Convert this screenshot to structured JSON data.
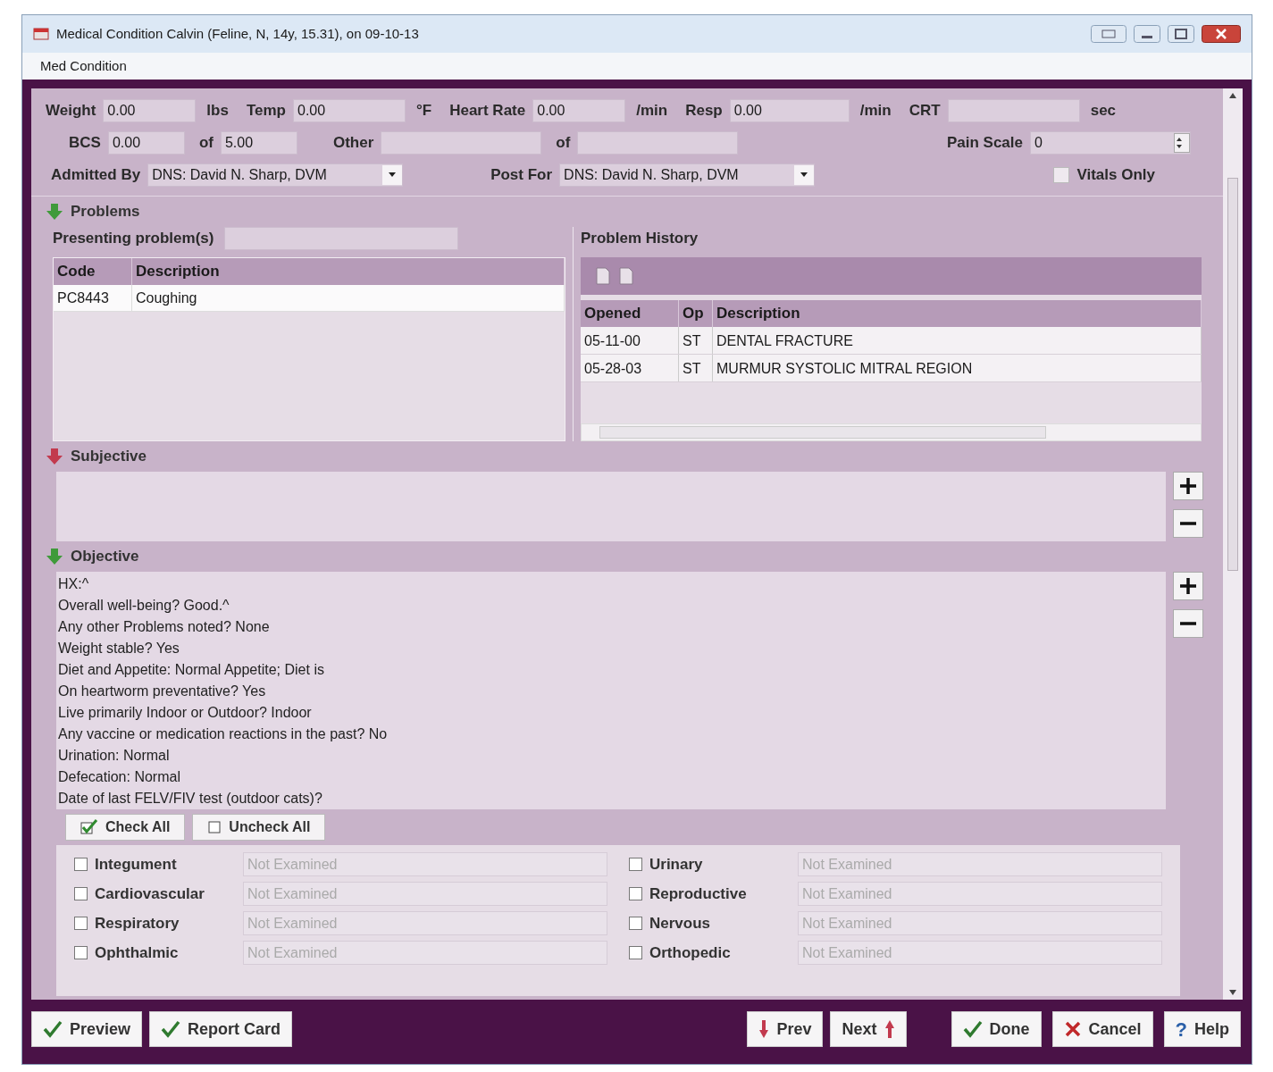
{
  "window": {
    "title": "Medical Condition  Calvin (Feline, N, 14y, 15.31), on 09-10-13",
    "menu": [
      "Med Condition"
    ]
  },
  "vitals": {
    "row1": [
      {
        "label": "Weight",
        "value": "0.00",
        "unit": "lbs"
      },
      {
        "label": "Temp",
        "value": "0.00",
        "unit": "°F"
      },
      {
        "label": "Heart Rate",
        "value": "0.00",
        "unit": "/min"
      },
      {
        "label": "Resp",
        "value": "0.00",
        "unit": "/min"
      },
      {
        "label": "CRT",
        "unit": "sec"
      }
    ],
    "row2": [
      {
        "kind": "field",
        "label": "BCS",
        "value": "0.00"
      },
      {
        "kind": "field",
        "label": "of",
        "value": "5.00"
      },
      {
        "kind": "field",
        "label": "Other"
      },
      {
        "kind": "field",
        "label": "of"
      },
      {
        "kind": "spin",
        "label": "Pain Scale",
        "value": "0"
      }
    ],
    "admitted_by": {
      "label": "Admitted By",
      "value": "DNS: David N. Sharp, DVM"
    },
    "post_for": {
      "label": "Post For",
      "value": "DNS: David N. Sharp, DVM"
    },
    "vitals_only": {
      "label": "Vitals Only",
      "checked": false
    }
  },
  "sections": [
    {
      "title": "Problems",
      "color": "#3f9a3a"
    },
    {
      "title": "Subjective",
      "color": "#c23a4e"
    },
    {
      "title": "Objective",
      "color": "#3f9a3a"
    }
  ],
  "presenting": {
    "label": "Presenting problem(s)",
    "columns": [
      "Code",
      "Description"
    ],
    "rows": [
      [
        "PC8443",
        "Coughing"
      ]
    ]
  },
  "history": {
    "title": "Problem History",
    "columns": [
      "Opened",
      "Op",
      "Description"
    ],
    "rows": [
      [
        "05-11-00",
        "ST",
        "DENTAL FRACTURE"
      ],
      [
        "05-28-03",
        "ST",
        "MURMUR SYSTOLIC MITRAL REGION"
      ]
    ]
  },
  "objective_lines": [
    "HX:^",
    "Overall well-being? Good.^",
    "Any other Problems noted? None",
    "Weight stable? Yes",
    "Diet and Appetite: Normal Appetite; Diet is",
    "On heartworm preventative? Yes",
    "Live primarily Indoor or Outdoor? Indoor",
    "Any vaccine or medication reactions in the past? No",
    "Urination: Normal",
    "Defecation: Normal",
    "Date of last FELV/FIV test (outdoor cats)?"
  ],
  "check_buttons": [
    {
      "kind": "check",
      "label": "Check All"
    },
    {
      "kind": "uncheck",
      "label": "Uncheck All"
    }
  ],
  "exam": [
    {
      "label": "Integument",
      "checked": false,
      "placeholder": "Not Examined"
    },
    {
      "label": "Urinary",
      "checked": false,
      "placeholder": "Not Examined"
    },
    {
      "label": "Cardiovascular",
      "checked": false,
      "placeholder": "Not Examined"
    },
    {
      "label": "Reproductive",
      "checked": false,
      "placeholder": "Not Examined"
    },
    {
      "label": "Respiratory",
      "checked": false,
      "placeholder": "Not Examined"
    },
    {
      "label": "Nervous",
      "checked": false,
      "placeholder": "Not Examined"
    },
    {
      "label": "Ophthalmic",
      "checked": false,
      "placeholder": "Not Examined"
    },
    {
      "label": "Orthopedic",
      "checked": false,
      "placeholder": "Not Examined"
    }
  ],
  "footer": {
    "left": [
      {
        "kind": "check",
        "label": "Preview"
      },
      {
        "kind": "check",
        "label": "Report Card"
      }
    ],
    "middle": [
      {
        "kind": "prev",
        "label": "Prev"
      },
      {
        "kind": "next",
        "label": "Next"
      }
    ],
    "right": [
      {
        "kind": "check",
        "label": "Done"
      },
      {
        "kind": "cancel",
        "label": "Cancel"
      },
      {
        "kind": "help",
        "icon": "?",
        "label": "Help"
      }
    ]
  }
}
